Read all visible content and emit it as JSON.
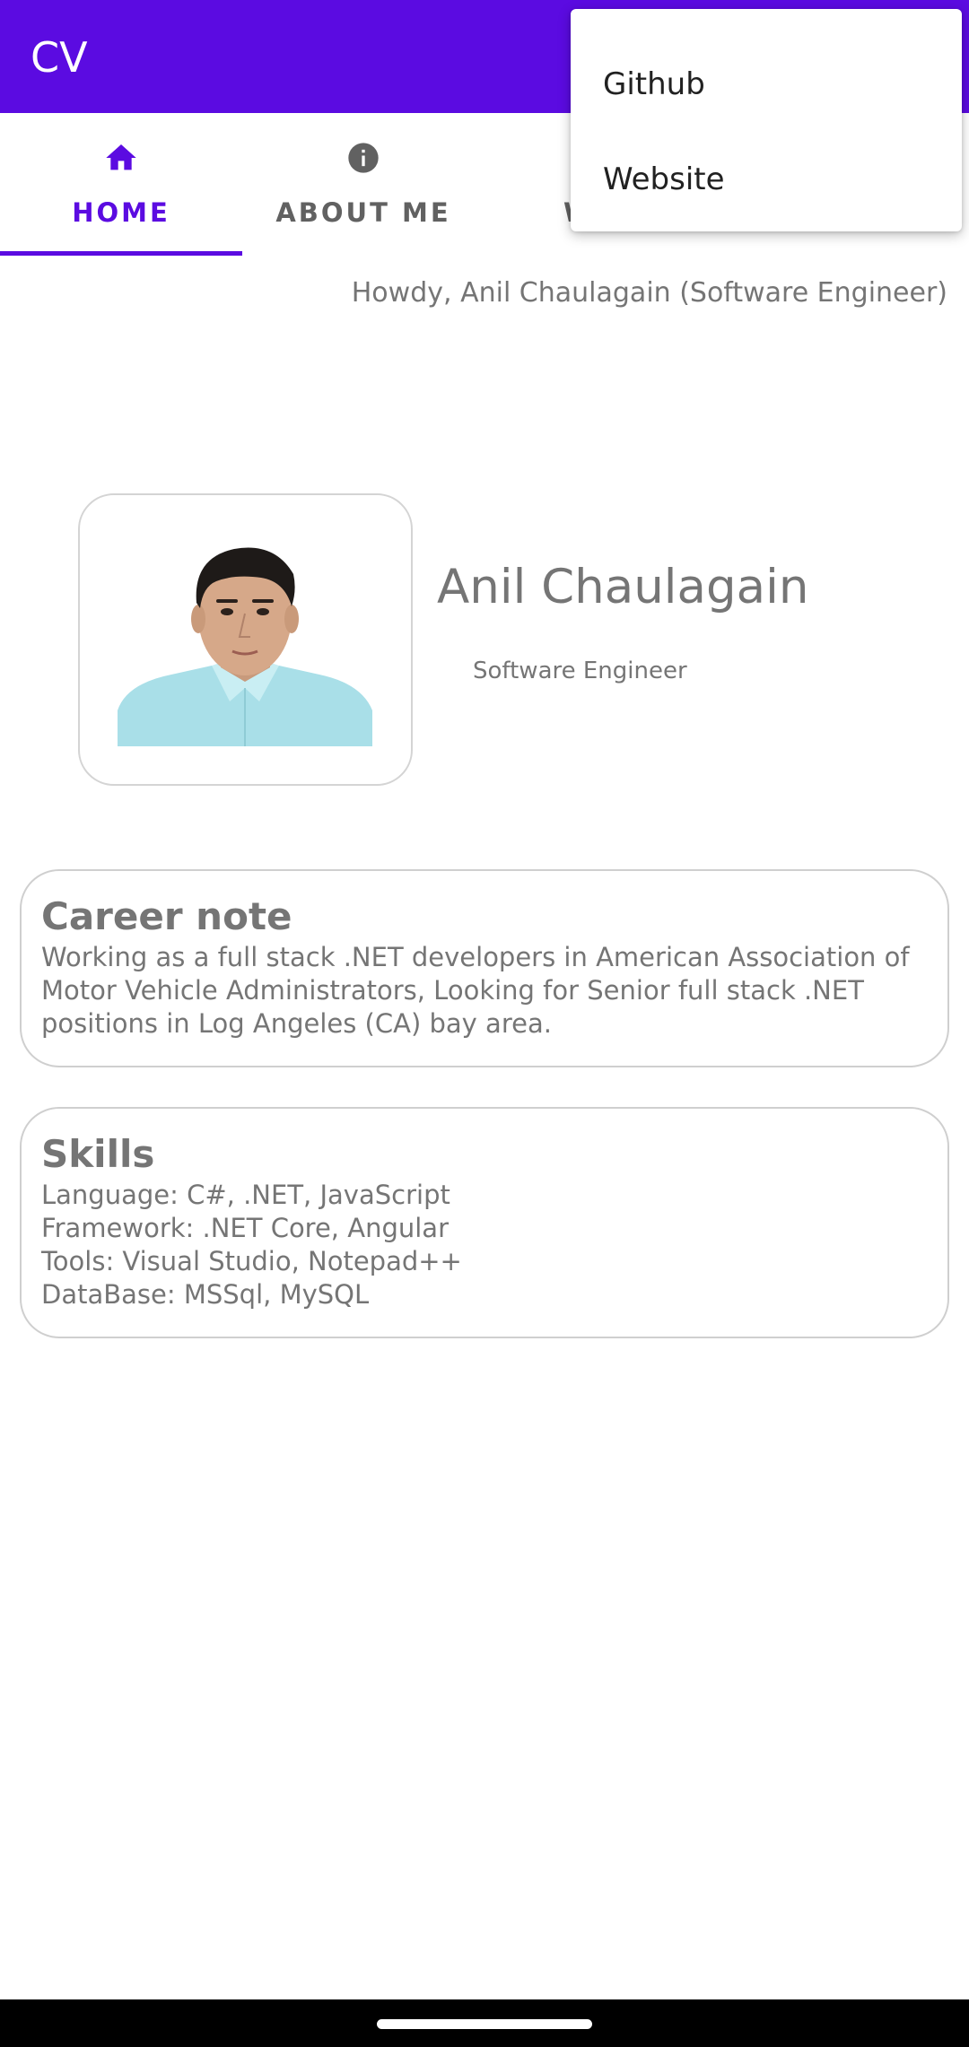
{
  "app": {
    "title": "CV",
    "primary_color": "#5b0be1"
  },
  "tabs": [
    {
      "label": "HOME",
      "icon": "home-icon",
      "active": true
    },
    {
      "label": "ABOUT ME",
      "icon": "info-icon",
      "active": false
    },
    {
      "label": "W",
      "icon": "",
      "active": false
    }
  ],
  "greeting": "Howdy, Anil Chaulagain (Software Engineer)",
  "profile": {
    "name": "Anil Chaulagain",
    "role": "Software Engineer"
  },
  "career": {
    "title": "Career note",
    "body": "Working as a full stack .NET developers in American Association of Motor Vehicle Administrators, Looking for Senior full stack .NET positions in Log Angeles (CA) bay area."
  },
  "skills": {
    "title": "Skills",
    "lines": [
      "Language: C#, .NET, JavaScript",
      "Framework: .NET Core, Angular",
      "Tools: Visual Studio, Notepad++",
      "DataBase: MSSql, MySQL"
    ]
  },
  "menu": {
    "items": [
      {
        "label": "Github"
      },
      {
        "label": "Website"
      }
    ]
  }
}
